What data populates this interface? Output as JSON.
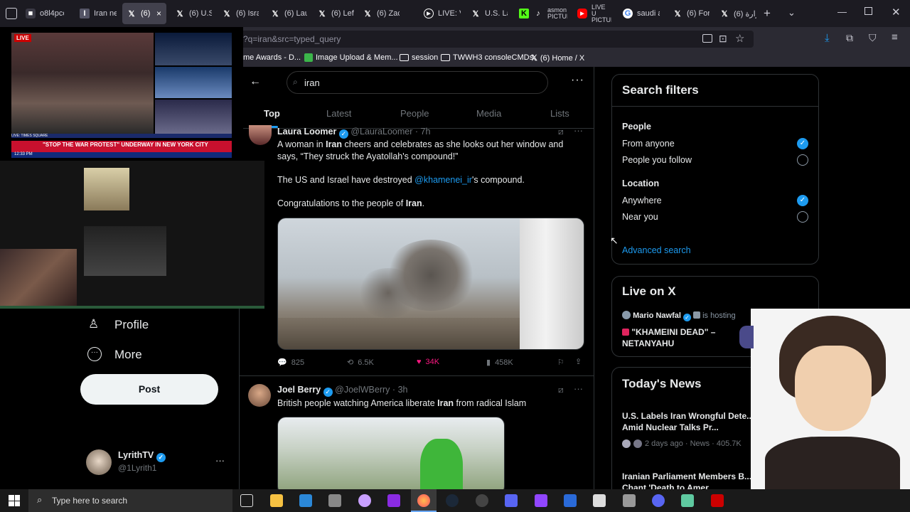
{
  "browser": {
    "tabs": [
      {
        "label": "o8l4pcon4",
        "icon": "tab-icon-generic"
      },
      {
        "label": "Iran ne",
        "icon": "tab-icon-news"
      },
      {
        "label": "(6) I",
        "icon": "x-icon"
      },
      {
        "label": "(6) U.S.",
        "icon": "x-icon"
      },
      {
        "label": "(6) Isra",
        "icon": "x-icon"
      },
      {
        "label": "(6) Lau",
        "icon": "x-icon"
      },
      {
        "label": "(6) Left",
        "icon": "x-icon"
      },
      {
        "label": "(6) Zac",
        "icon": "x-icon"
      },
      {
        "label": "LIVE: V",
        "icon": "live-icon"
      },
      {
        "label": "U.S. La",
        "icon": "x-icon"
      },
      {
        "label": "asmon PICTURE",
        "icon": "kick-icon"
      },
      {
        "label": "LIVE U PICTURE",
        "icon": "youtube-icon"
      },
      {
        "label": "saudi a",
        "icon": "google-icon"
      },
      {
        "label": "(6) For",
        "icon": "x-icon"
      },
      {
        "label": "(6) وزارة",
        "icon": "x-icon"
      }
    ],
    "url": "?q=iran&src=typed_query",
    "bookmarks": [
      {
        "label": "me Awards - D...",
        "icon": "bookmark-icon"
      },
      {
        "label": "Image Upload & Mem...",
        "icon": "image-icon"
      },
      {
        "label": "session",
        "icon": "folder-icon"
      },
      {
        "label": "TWWH3 consoleCMDs",
        "icon": "folder-icon"
      },
      {
        "label": "(6) Home / X",
        "icon": "x-icon"
      }
    ]
  },
  "search": {
    "query": "iran",
    "tabs": [
      "Top",
      "Latest",
      "People",
      "Media",
      "Lists"
    ],
    "active_tab": "Top"
  },
  "tweets": [
    {
      "name": "Laura Loomer",
      "handle": "@LauraLoomer",
      "time": "7h",
      "text_parts": {
        "p1_a": "A woman in ",
        "p1_b": "Iran",
        "p1_c": " cheers and celebrates as she looks out her window and says, “They struck the Ayatollah's compound!”",
        "p2_a": "The US and Israel have destroyed ",
        "p2_b": "@khamenei_ir",
        "p2_c": "'s compound.",
        "p3_a": "Congratulations to the people of ",
        "p3_b": "Iran",
        "p3_c": "."
      },
      "replies": "825",
      "reposts": "6.5K",
      "likes": "34K",
      "views": "458K",
      "liked": true
    },
    {
      "name": "Joel Berry",
      "handle": "@JoelWBerry",
      "time": "3h",
      "text_a": "British people watching America liberate ",
      "text_b": "Iran",
      "text_c": " from radical Islam"
    }
  ],
  "search_filters": {
    "title": "Search filters",
    "people_heading": "People",
    "people_options": [
      {
        "label": "From anyone",
        "selected": true
      },
      {
        "label": "People you follow",
        "selected": false
      }
    ],
    "location_heading": "Location",
    "location_options": [
      {
        "label": "Anywhere",
        "selected": true
      },
      {
        "label": "Near you",
        "selected": false
      }
    ],
    "advanced_link": "Advanced search"
  },
  "live_on_x": {
    "title": "Live on X",
    "host": "Mario Nawfal",
    "hosting_text": "is hosting",
    "space_title": "\"KHAMEINI DEAD\" – NETANYAHU"
  },
  "todays_news": {
    "title": "Today's News",
    "items": [
      {
        "headline": "U.S. Labels Iran Wrongful Dete... Sponsor Amid Nuclear Talks Pr...",
        "meta": "2 days ago · News · 405.7K"
      },
      {
        "headline": "Iranian Parliament Members B... Flag and Chant 'Death to Amer..."
      }
    ]
  },
  "left_nav": {
    "profile_label": "Profile",
    "more_label": "More",
    "post_button": "Post",
    "account_name": "LyrithTV",
    "account_handle": "@1Lyrith1"
  },
  "stream_overlay": {
    "headline": "\"STOP THE WAR PROTEST\" UNDERWAY IN NEW YORK CITY",
    "badge": "LIVE",
    "ticker_time": "12:33 PM",
    "top_banner": "LIVE: TIMES SQUARE"
  },
  "taskbar": {
    "search_placeholder": "Type here to search"
  },
  "colors": {
    "accent": "#1d9bf0",
    "like": "#f91880",
    "background": "#000000"
  }
}
